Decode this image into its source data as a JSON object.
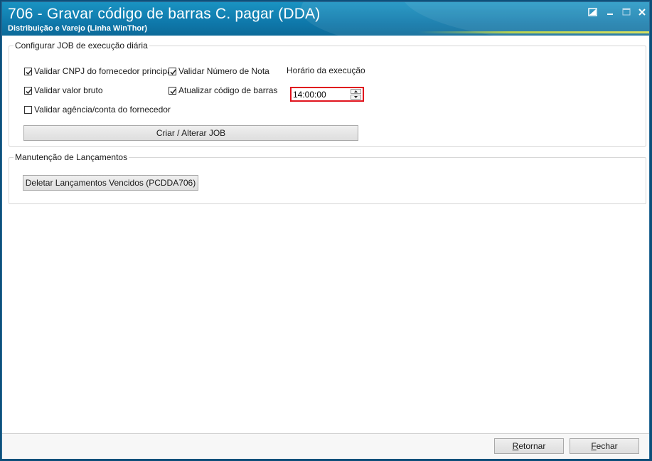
{
  "window": {
    "title": "706 - Gravar código de barras C. pagar (DDA)",
    "subtitle": "Distribuição e Varejo (Linha WinThor)"
  },
  "job_section": {
    "legend": "Configurar JOB de execução diária",
    "checkboxes": [
      {
        "label": "Validar CNPJ do fornecedor principal",
        "checked": true
      },
      {
        "label": "Validar Número de Nota",
        "checked": true
      },
      {
        "label": "Validar valor bruto",
        "checked": true
      },
      {
        "label": "Atualizar código de barras",
        "checked": true
      },
      {
        "label": "Validar agência/conta do fornecedor",
        "checked": false
      }
    ],
    "time_label": "Horário da execução",
    "time_value": "14:00:00",
    "button_label": "Criar / Alterar JOB"
  },
  "maintenance_section": {
    "legend": "Manutenção de Lançamentos",
    "button_label": "Deletar Lançamentos Vencidos (PCDDA706)"
  },
  "footer": {
    "return_first": "R",
    "return_rest": "etornar",
    "close_first": "F",
    "close_rest": "echar"
  },
  "colors": {
    "titlebar": "#0f79ab",
    "highlight_border": "#e0141e",
    "accent_line": "#b9d250"
  },
  "icons": {
    "restore": "restore-icon",
    "minimize": "minimize-icon",
    "maximize": "maximize-icon",
    "close": "close-icon",
    "check": "checkmark-icon"
  }
}
